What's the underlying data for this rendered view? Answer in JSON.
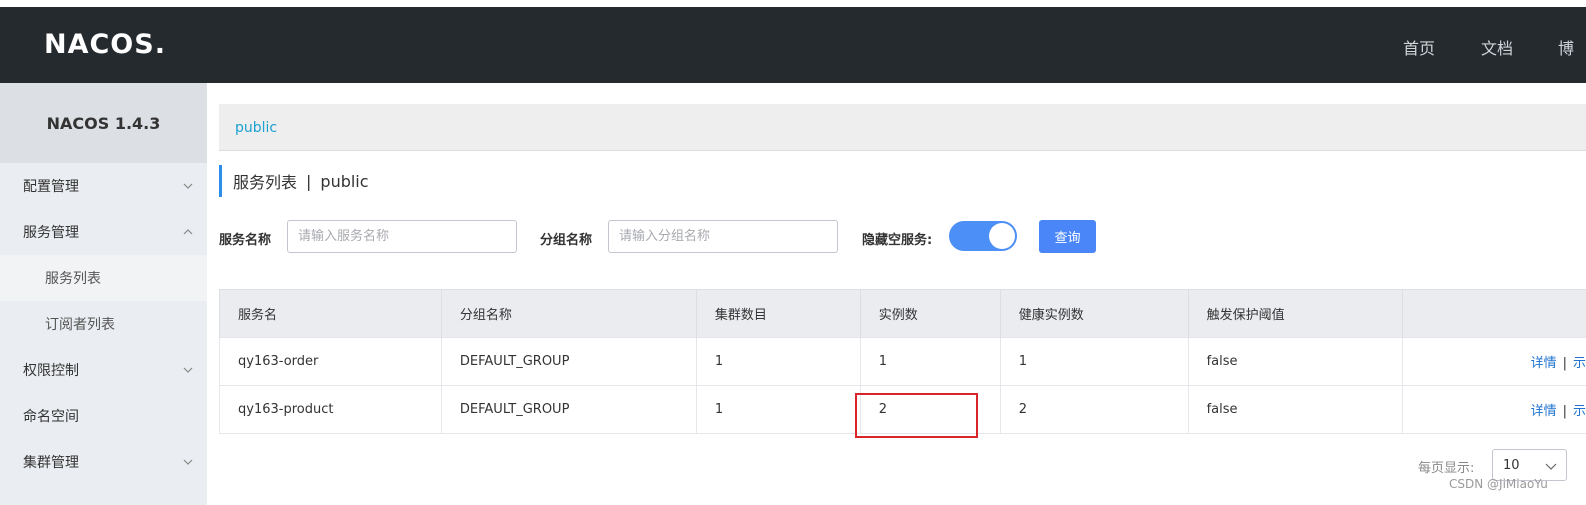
{
  "header": {
    "logo": "NACOS.",
    "nav": [
      "首页",
      "文档",
      "博"
    ]
  },
  "sidebar": {
    "title": "NACOS 1.4.3",
    "items": [
      {
        "label": "配置管理"
      },
      {
        "label": "服务管理"
      },
      {
        "label": "服务列表"
      },
      {
        "label": "订阅者列表"
      },
      {
        "label": "权限控制"
      },
      {
        "label": "命名空间"
      },
      {
        "label": "集群管理"
      }
    ]
  },
  "namespace_tab": "public",
  "page_title": {
    "main": "服务列表",
    "sep": "|",
    "namespace": "public"
  },
  "filters": {
    "service_name_label": "服务名称",
    "service_name_placeholder": "请输入服务名称",
    "group_name_label": "分组名称",
    "group_name_placeholder": "请输入分组名称",
    "hide_empty_label": "隐藏空服务:",
    "hide_empty_on": true,
    "query_button": "查询"
  },
  "table": {
    "headers": [
      "服务名",
      "分组名称",
      "集群数目",
      "实例数",
      "健康实例数",
      "触发保护阈值",
      ""
    ],
    "rows": [
      {
        "name": "qy163-order",
        "group": "DEFAULT_GROUP",
        "clusters": "1",
        "instances": "1",
        "healthy": "1",
        "threshold": "false",
        "op_detail": "详情",
        "op_sep": "|",
        "op_more": "示"
      },
      {
        "name": "qy163-product",
        "group": "DEFAULT_GROUP",
        "clusters": "1",
        "instances": "2",
        "healthy": "2",
        "threshold": "false",
        "op_detail": "详情",
        "op_sep": "|",
        "op_more": "示"
      }
    ]
  },
  "pagination": {
    "per_page_label": "每页显示:",
    "per_page_value": "10"
  },
  "watermark": "CSDN @JiMiaoYu"
}
